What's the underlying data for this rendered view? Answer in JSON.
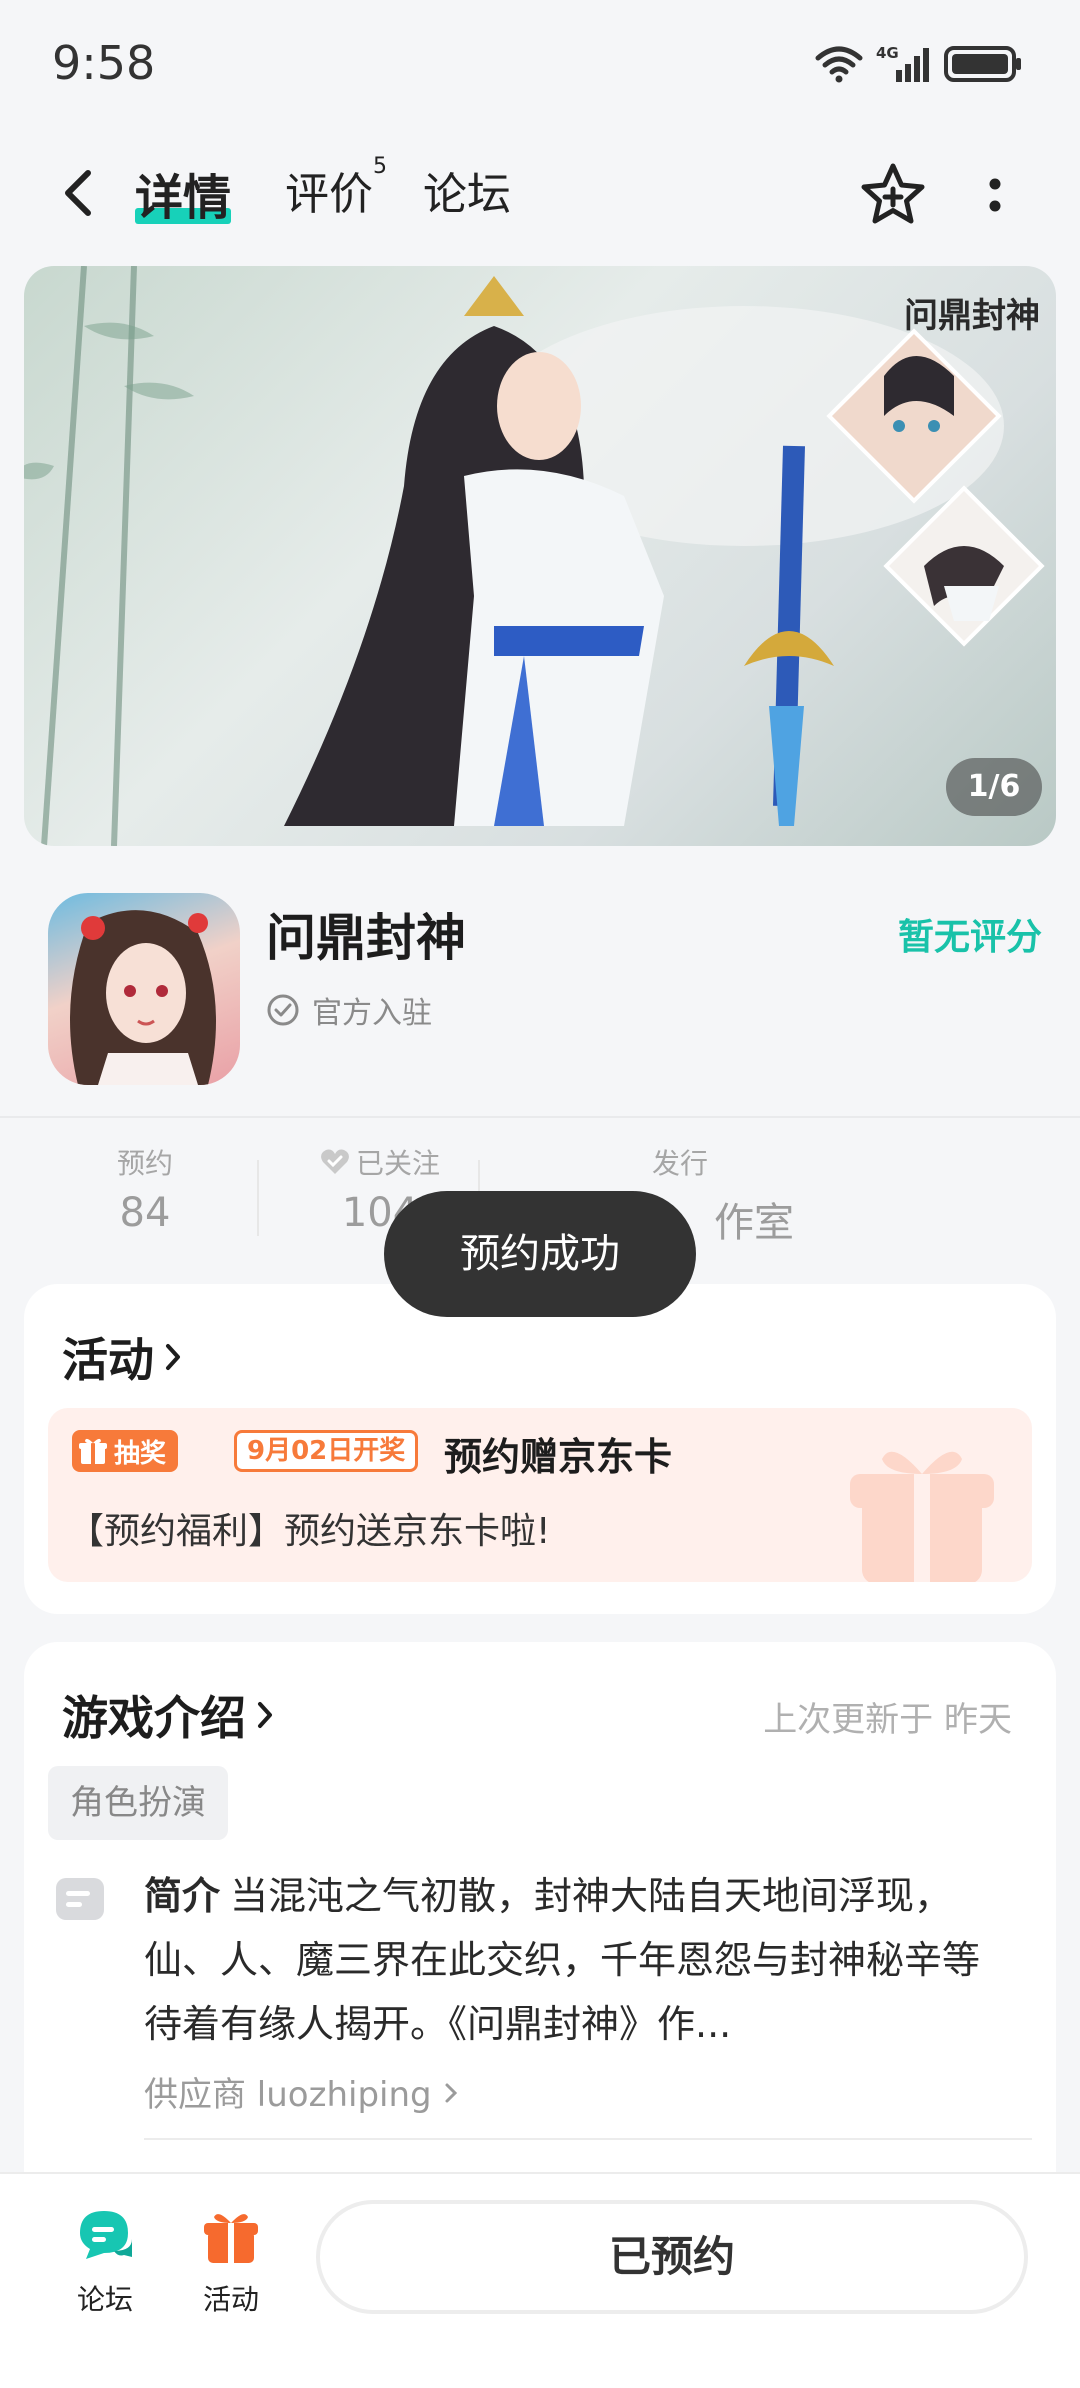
{
  "status_bar": {
    "time": "9:58",
    "network": "4G"
  },
  "header": {
    "tabs": [
      {
        "label": "详情",
        "active": true
      },
      {
        "label": "评价",
        "badge": "5"
      },
      {
        "label": "论坛"
      }
    ],
    "icons": [
      "back-icon",
      "star-plus-icon",
      "more-vertical-icon"
    ]
  },
  "banner": {
    "counter": "1/6",
    "logo_text": "问鼎封神"
  },
  "game": {
    "name": "问鼎封神",
    "official_label": "官方入驻",
    "rating_text": "暂无评分"
  },
  "stats": [
    {
      "label": "预约",
      "value": "84"
    },
    {
      "label": "已关注",
      "value": "104"
    },
    {
      "label": "发行",
      "value": "作室"
    }
  ],
  "toast": "预约成功",
  "activity": {
    "section_title": "活动",
    "lottery_tag": "抽奖",
    "date_tag": "9月02日开奖",
    "title": "预约赠京东卡",
    "description": "【预约福利】预约送京东卡啦!"
  },
  "intro": {
    "section_title": "游戏介绍",
    "updated": "上次更新于 昨天",
    "genre": "角色扮演",
    "brief_label": "简介",
    "brief_text": "当混沌之气初散，封神大陆自天地间浮现，仙、人、魔三界在此交织，千年恩怨与封神秘辛等待着有缘人揭开。《问鼎封神》作...",
    "supplier": "供应商 luozhiping"
  },
  "bottom_bar": {
    "forum_label": "论坛",
    "activity_label": "活动",
    "reserve_button": "已预约"
  },
  "colors": {
    "accent": "#17d1b9",
    "orange": "#f77a3a",
    "toast_bg": "#333333"
  }
}
